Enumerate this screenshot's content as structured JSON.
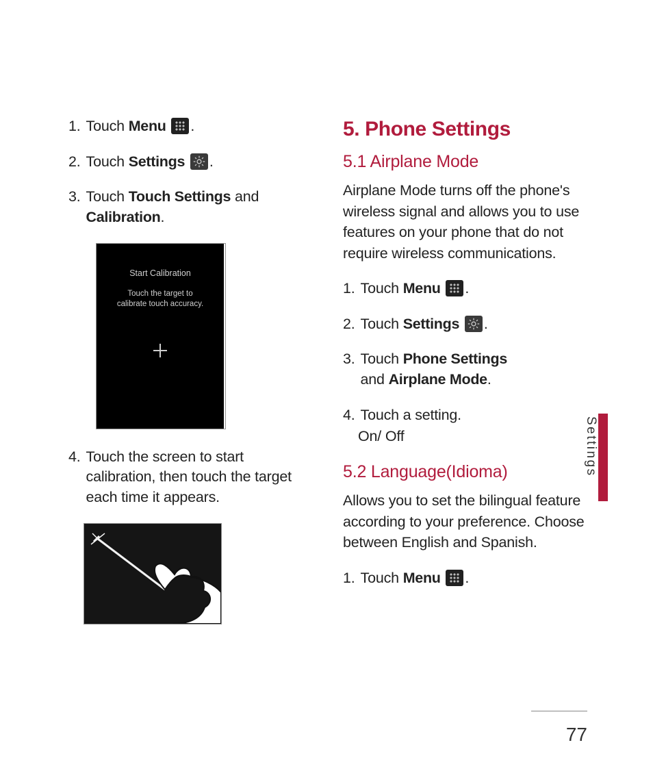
{
  "page_number": "77",
  "side_tab": "Settings",
  "icons": {
    "menu": "menu-grid-icon",
    "settings": "settings-gear-icon"
  },
  "left": {
    "steps": {
      "s1": {
        "num": "1.",
        "pre": "Touch ",
        "bold": "Menu",
        "post": " ",
        "icon": "menu",
        "tail": "."
      },
      "s2": {
        "num": "2.",
        "pre": "Touch ",
        "bold": "Settings",
        "post": " ",
        "icon": "settings",
        "tail": "."
      },
      "s3": {
        "num": "3.",
        "pre": "Touch ",
        "bold1": "Touch Settings",
        "mid": " and ",
        "bold2": "Calibration",
        "tail": "."
      },
      "s4": {
        "num": "4.",
        "text": "Touch the screen to start calibration, then touch the target each time it appears."
      }
    },
    "calibration_screen": {
      "title": "Start Calibration",
      "instruction_l1": "Touch the target to",
      "instruction_l2": "calibrate touch accuracy."
    },
    "stylus_alt": "Hand holding a stylus touching the screen"
  },
  "right": {
    "heading": "5. Phone Settings",
    "sec1": {
      "title": "5.1 Airplane Mode",
      "para": "Airplane Mode turns off the phone's wireless signal and allows you to use features on your phone that do not require wireless communications.",
      "s1": {
        "num": "1.",
        "pre": "Touch ",
        "bold": "Menu",
        "post": " ",
        "icon": "menu",
        "tail": "."
      },
      "s2": {
        "num": "2.",
        "pre": "Touch ",
        "bold": "Settings",
        "post": " ",
        "icon": "settings",
        "tail": "."
      },
      "s3": {
        "num": "3.",
        "pre": "Touch ",
        "bold1": "Phone Settings",
        "mid": " and ",
        "bold2": "Airplane Mode",
        "tail": "."
      },
      "s4": {
        "num": "4.",
        "text": "Touch a setting."
      },
      "s4_sub": "On/ Off"
    },
    "sec2": {
      "title": "5.2 Language(Idioma)",
      "para": "Allows you to set the bilingual feature according to your preference. Choose between English and Spanish.",
      "s1": {
        "num": "1.",
        "pre": "Touch ",
        "bold": "Menu",
        "post": " ",
        "icon": "menu",
        "tail": "."
      }
    }
  }
}
